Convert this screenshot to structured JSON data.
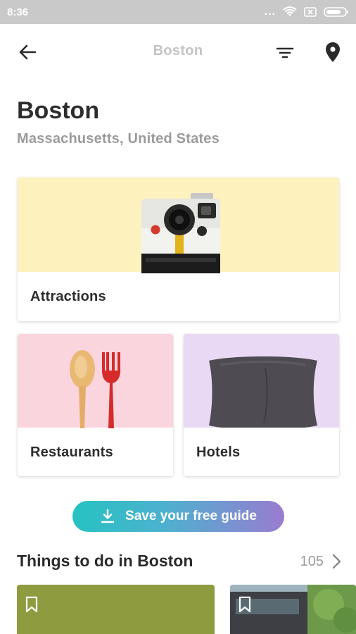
{
  "status_bar": {
    "time": "8:36",
    "dots": "...",
    "battery_icon": "battery-icon",
    "wifi_icon": "wifi-icon"
  },
  "app_bar": {
    "title": "Boston",
    "back_icon": "arrow-left-icon",
    "filter_icon": "filter-icon",
    "location_icon": "location-pin-icon"
  },
  "header": {
    "city": "Boston",
    "region": "Massachusetts, United States"
  },
  "categories": [
    {
      "label": "Attractions",
      "color": "#fdf2bd"
    },
    {
      "label": "Restaurants",
      "color": "#fbd5de"
    },
    {
      "label": "Hotels",
      "color": "#ead9f5"
    }
  ],
  "guide_button": {
    "label": "Save your free guide",
    "icon": "download-icon"
  },
  "things_to_do": {
    "title": "Things to do in Boston",
    "count": "105"
  }
}
